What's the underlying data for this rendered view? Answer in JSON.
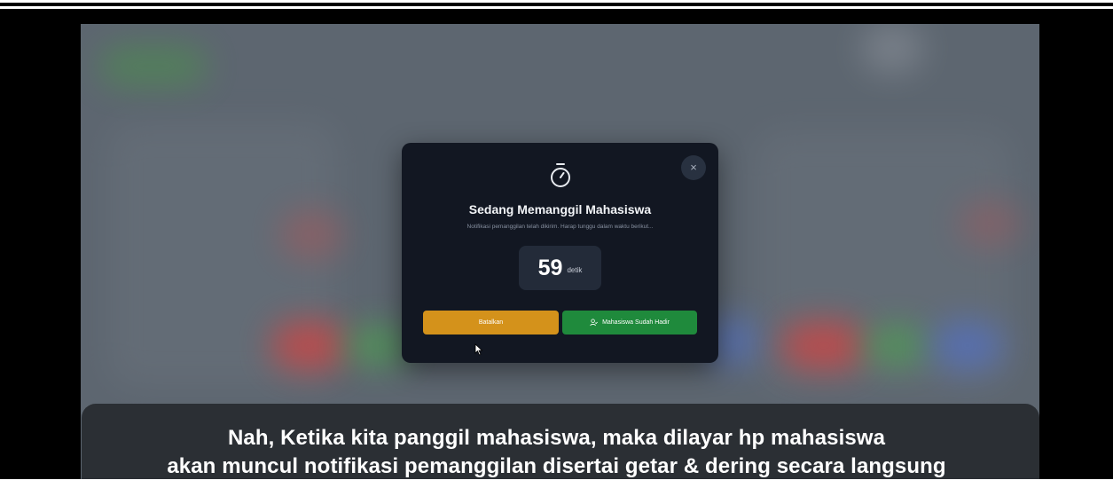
{
  "dialog": {
    "title": "Sedang Memanggil Mahasiswa",
    "description": "Notifikasi pemanggilan telah dikirim. Harap tunggu dalam waktu berikut...",
    "countdown": {
      "value": "59",
      "unit": "detik"
    },
    "close_label": "×",
    "cancel_label": "Batalkan",
    "present_label": "Mahasiswa Sudah Hadir",
    "icons": {
      "header": "stopwatch-icon",
      "close": "close-icon",
      "present": "user-check-icon"
    }
  },
  "caption": {
    "line1": "Nah, Ketika kita panggil mahasiswa, maka dilayar hp mahasiswa",
    "line2": "akan muncul notifikasi pemanggilan disertai getar & dering secara langsung"
  },
  "colors": {
    "modal_bg": "#121722",
    "cancel_button": "#d4921b",
    "present_button": "#1f8a3c",
    "overlay": "#5d6670"
  }
}
